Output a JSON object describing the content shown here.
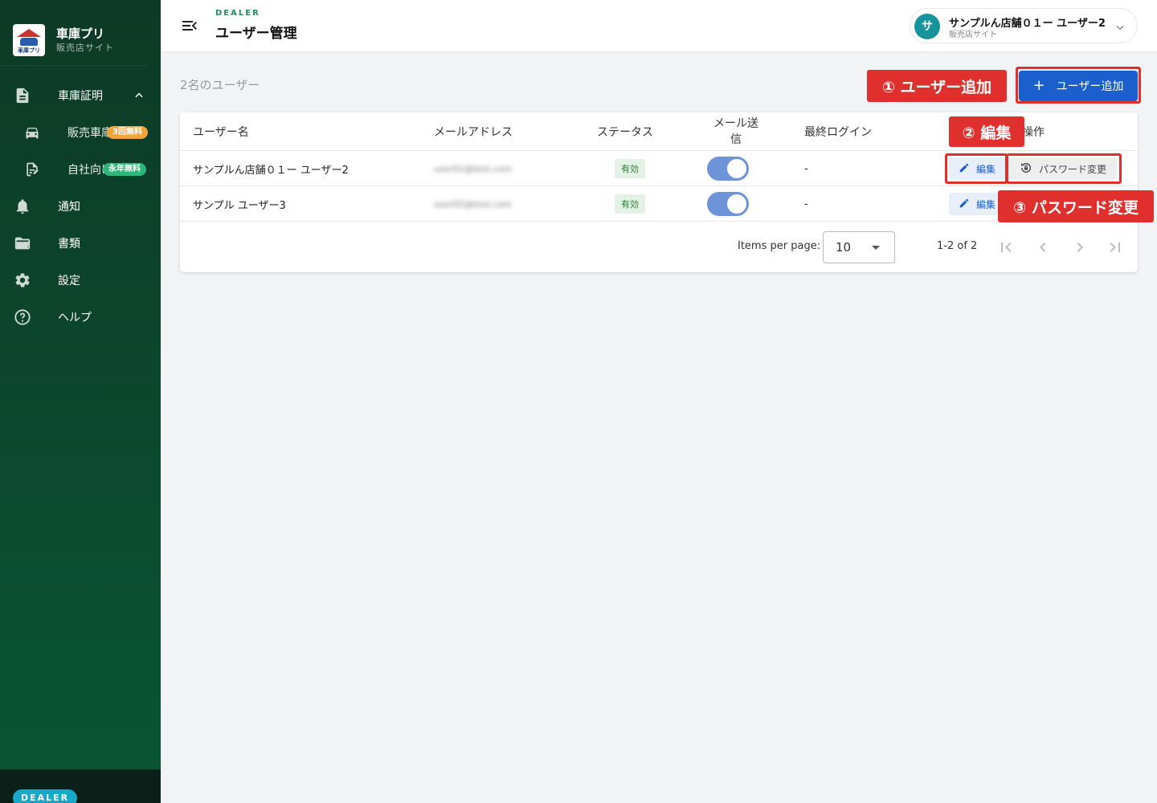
{
  "sidebar": {
    "brand_title": "車庫プリ",
    "brand_sub": "販売店サイト",
    "logo_text": "車庫プリ",
    "items": [
      {
        "label": "車庫証明",
        "icon": "document-icon"
      },
      {
        "label": "販売車庫",
        "icon": "car-icon",
        "badge": "3回無料"
      },
      {
        "label": "自社向け",
        "icon": "edit-document-icon",
        "badge": "永年無料"
      },
      {
        "label": "通知",
        "icon": "bell-icon"
      },
      {
        "label": "書類",
        "icon": "folder-icon"
      },
      {
        "label": "設定",
        "icon": "gear-icon"
      },
      {
        "label": "ヘルプ",
        "icon": "help-icon"
      }
    ],
    "footer_badge": "DEALER"
  },
  "header": {
    "kicker": "DEALER",
    "title": "ユーザー管理",
    "user_initial": "サ",
    "user_name": "サンプルん店舗０１ー ユーザー2",
    "user_role": "販売店サイト"
  },
  "main": {
    "count_label": "2名のユーザー",
    "add_button_label": "ユーザー追加",
    "table": {
      "headers": [
        "ユーザー名",
        "メールアドレス",
        "ステータス",
        "メール送信",
        "最終ログイン",
        "操作"
      ],
      "rows": [
        {
          "name": "サンプルん店舗０１ー ユーザー2",
          "email": "user01@test.com",
          "status": "有効",
          "mail_enabled": true,
          "last_login": "-",
          "edit": "編集",
          "password": "パスワード変更"
        },
        {
          "name": "サンプル ユーザー3",
          "email": "user02@test.com",
          "status": "有効",
          "mail_enabled": true,
          "last_login": "-",
          "edit": "編集"
        }
      ]
    },
    "pager": {
      "items_per_page_label": "Items per page:",
      "items_per_page": "10",
      "range": "1-2 of 2"
    }
  },
  "annotations": {
    "a1": "① ユーザー追加",
    "a2": "② 編集",
    "a3": "③ パスワード変更"
  },
  "colors": {
    "sidebar": "#0b4a30",
    "primary": "#1a5fcc",
    "annotation": "#e0302e"
  }
}
